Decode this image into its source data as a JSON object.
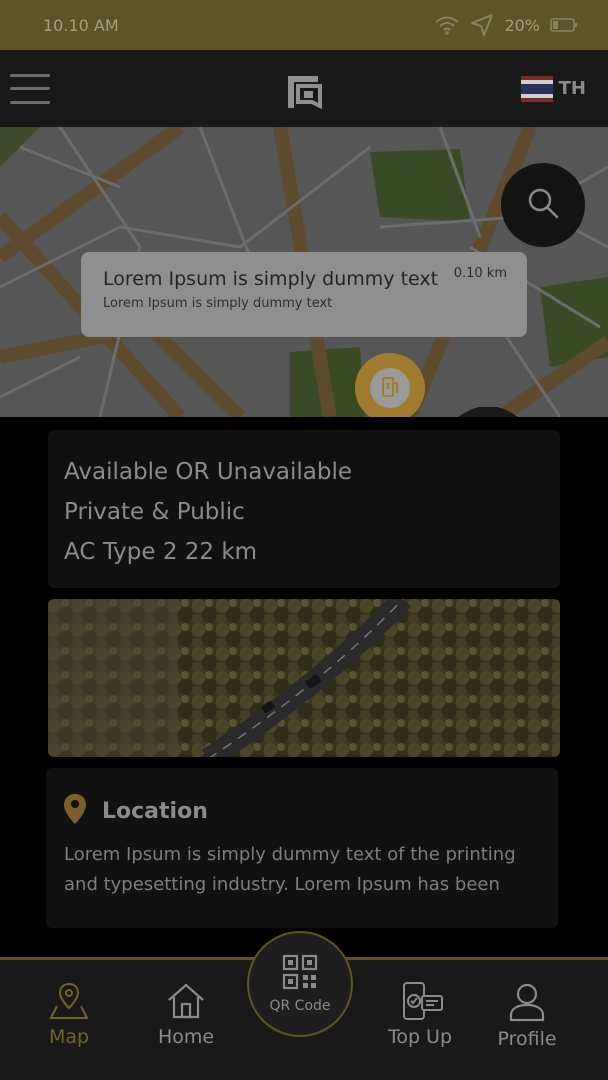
{
  "status_bar": {
    "time": "10.10 AM",
    "battery": "20%"
  },
  "header": {
    "language_code": "TH"
  },
  "map_card": {
    "title": "Lorem Ipsum is simply dummy text",
    "subtitle": "Lorem Ipsum is simply dummy text",
    "distance": "0.10 km"
  },
  "details": {
    "availability": "Available OR Unavailable",
    "access": "Private & Public",
    "charger": "AC Type 2 22 km"
  },
  "location": {
    "heading": "Location",
    "description_line1": "Lorem Ipsum is simply dummy text of the printing",
    "description_line2": "and typesetting industry. Lorem Ipsum has been"
  },
  "nav": {
    "map": "Map",
    "home": "Home",
    "qr": "QR Code",
    "topup": "Top Up",
    "profile": "Profile"
  },
  "colors": {
    "brand_gold": "#5e5426",
    "active_nav": "#6f6329",
    "pin": "#a07c2e"
  }
}
